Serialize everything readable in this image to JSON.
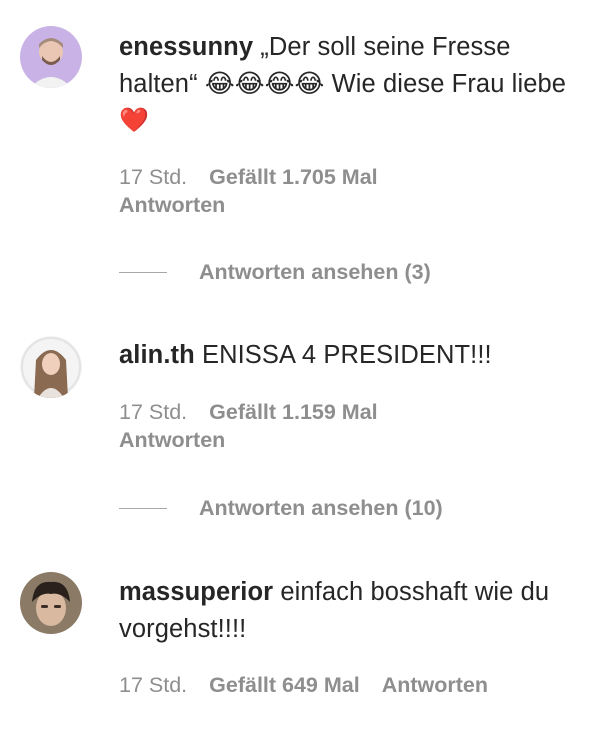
{
  "comments": [
    {
      "username": "enessunny",
      "text": " „Der soll seine Fresse halten“ 😂😂😂😂 Wie diese Frau liebe ",
      "emoji_suffix": "❤️",
      "time": "17 Std.",
      "likes": "Gefällt 1.705 Mal",
      "reply": "Antworten",
      "view_replies": "Antworten ansehen (3)"
    },
    {
      "username": "alin.th",
      "text": " ENISSA 4 PRESIDENT!!!",
      "time": "17 Std.",
      "likes": "Gefällt 1.159 Mal",
      "reply": "Antworten",
      "view_replies": "Antworten ansehen (10)"
    },
    {
      "username": "massuperior",
      "text": " einfach bosshaft wie du vorgehst!!!!",
      "time": "17 Std.",
      "likes": "Gefällt 649 Mal",
      "reply": "Antworten"
    }
  ]
}
